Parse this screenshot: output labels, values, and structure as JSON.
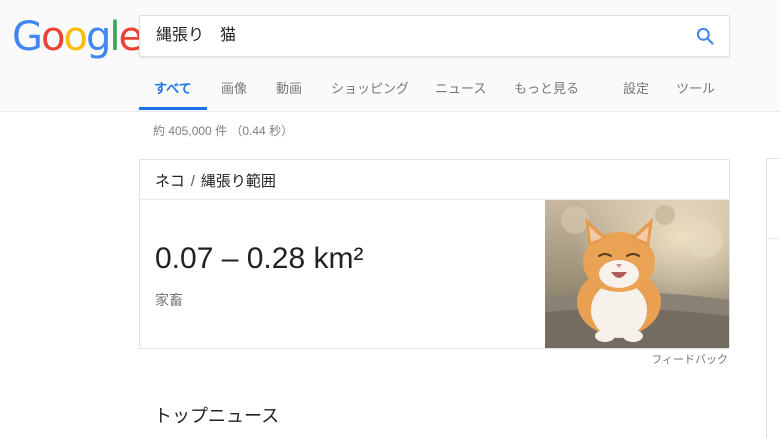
{
  "logo": {
    "letters": [
      "G",
      "o",
      "o",
      "g",
      "l",
      "e"
    ],
    "colors": [
      "#4285F4",
      "#EA4335",
      "#FBBC05",
      "#4285F4",
      "#34A853",
      "#EA4335"
    ]
  },
  "search": {
    "query": "縄張り　猫",
    "button_icon": "search-icon"
  },
  "tabs": [
    {
      "label": "すべて",
      "active": true
    },
    {
      "label": "画像",
      "active": false
    },
    {
      "label": "動画",
      "active": false
    },
    {
      "label": "ショッピング",
      "active": false
    },
    {
      "label": "ニュース",
      "active": false
    },
    {
      "label": "もっと見る",
      "active": false
    },
    {
      "label": "設定",
      "active": false
    },
    {
      "label": "ツール",
      "active": false
    }
  ],
  "result_stats": "約 405,000 件 （0.44 秒）",
  "knowledge_panel": {
    "breadcrumb_1": "ネコ",
    "breadcrumb_sep": "/",
    "breadcrumb_2": "縄張り範囲",
    "answer": "0.07 – 0.28 km²",
    "subtitle": "家畜",
    "image_subject": "cat-photo"
  },
  "feedback": "フィードバック",
  "top_news_title": "トップニュース",
  "colors": {
    "accent": "#1a73e8",
    "tab_text": "#777777"
  }
}
